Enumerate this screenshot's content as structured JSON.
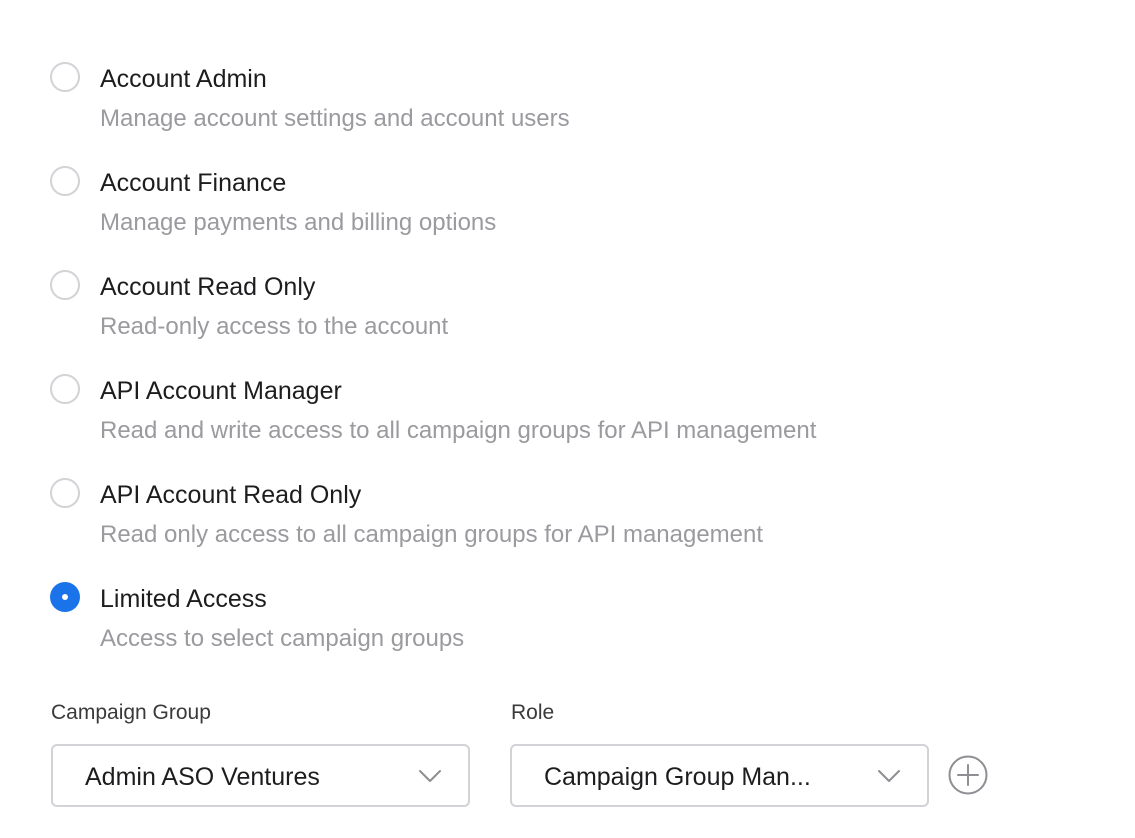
{
  "roles": [
    {
      "title": "Account Admin",
      "description": "Manage account settings and account users",
      "selected": false
    },
    {
      "title": "Account Finance",
      "description": "Manage payments and billing options",
      "selected": false
    },
    {
      "title": "Account Read Only",
      "description": "Read-only access to the account",
      "selected": false
    },
    {
      "title": "API Account Manager",
      "description": "Read and write access to all campaign groups for API management",
      "selected": false
    },
    {
      "title": "API Account Read Only",
      "description": "Read only access to all campaign groups for API management",
      "selected": false
    },
    {
      "title": "Limited Access",
      "description": "Access to select campaign groups",
      "selected": true
    }
  ],
  "limited_access": {
    "campaign_group_label": "Campaign Group",
    "campaign_group_value": "Admin ASO Ventures",
    "role_label": "Role",
    "role_value": "Campaign Group Man..."
  },
  "icons": {
    "dropdown": "chevron-down-icon",
    "add": "plus-circle-icon"
  },
  "colors": {
    "accent": "#1a73e8",
    "primary_text": "#1d1d1f",
    "secondary_text": "#9a9a9f",
    "border": "#d2d2d7"
  }
}
